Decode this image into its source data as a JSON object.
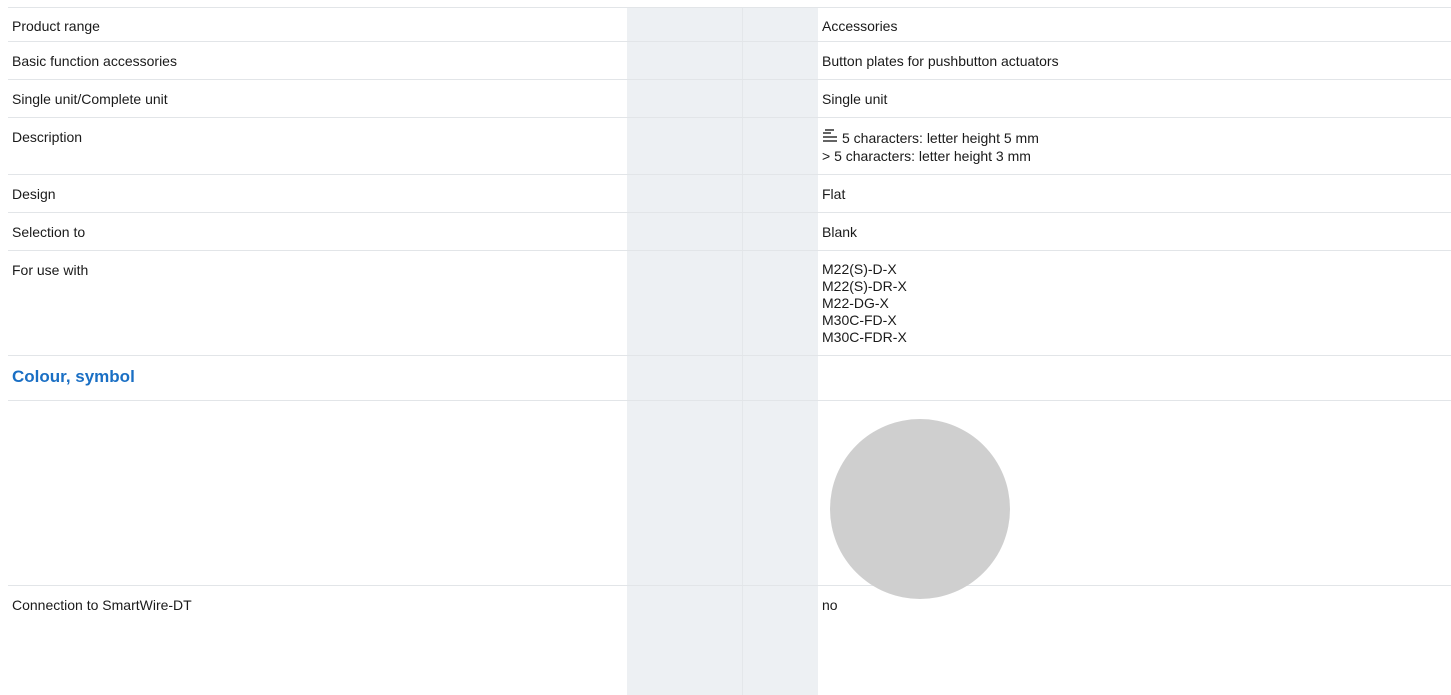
{
  "rows": [
    {
      "label": "Product range",
      "value": "Accessories"
    },
    {
      "label": "Basic function accessories",
      "value": "Button plates for pushbutton actuators"
    },
    {
      "label": "Single unit/Complete unit",
      "value": "Single unit"
    },
    {
      "label": "Description",
      "value_lines": [
        "5 characters: letter height 5 mm",
        "> 5 characters: letter height 3 mm"
      ],
      "icon": "text-lines-icon"
    },
    {
      "label": "Design",
      "value": "Flat"
    },
    {
      "label": "Selection to",
      "value": "Blank"
    },
    {
      "label": "For use with",
      "value_lines": [
        "M22(S)-D-X",
        "M22(S)-DR-X",
        "M22-DG-X",
        "M30C-FD-X",
        "M30C-FDR-X"
      ]
    }
  ],
  "section": {
    "title": "Colour, symbol"
  },
  "swatch": {
    "color": "#cfcfcf",
    "icon": "grey-circle-swatch"
  },
  "last_row": {
    "label": "Connection to SmartWire-DT",
    "value": "no"
  },
  "colors": {
    "accent": "#1a6fc4",
    "grey_column": "#edf0f3"
  }
}
